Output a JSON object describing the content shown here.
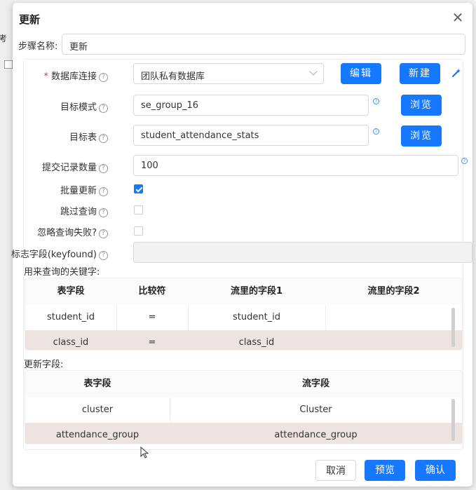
{
  "background": {
    "fragment_text": "考"
  },
  "dialog": {
    "title": "更新",
    "close_symbol": "✕",
    "step_name_label": "步骤名称:",
    "step_name_value": "更新"
  },
  "form": {
    "db_connection": {
      "label": "数据库连接",
      "required_mark": "*",
      "value": "团队私有数据库",
      "edit_label": "编辑",
      "new_label": "新建"
    },
    "target_schema": {
      "label": "目标模式",
      "value": "se_group_16",
      "browse_label": "浏览"
    },
    "target_table": {
      "label": "目标表",
      "value": "student_attendance_stats",
      "browse_label": "浏览"
    },
    "commit_size": {
      "label": "提交记录数量",
      "value": "100"
    },
    "batch_update": {
      "label": "批量更新",
      "checked": true
    },
    "skip_lookup": {
      "label": "跳过查询",
      "checked": false
    },
    "ignore_lookup_failure": {
      "label": "忽略查询失败?",
      "checked": false
    },
    "flag_field": {
      "label": "标志字段(keyfound)",
      "value": ""
    },
    "help_symbol": "?"
  },
  "key_table": {
    "section_label": "用来查询的关键字:",
    "headers": [
      "表字段",
      "比较符",
      "流里的字段1",
      "流里的字段2"
    ],
    "rows": [
      [
        "student_id",
        "=",
        "student_id",
        ""
      ],
      [
        "class_id",
        "=",
        "class_id",
        ""
      ]
    ]
  },
  "update_table": {
    "section_label": "更新字段:",
    "headers": [
      "表字段",
      "流字段"
    ],
    "rows": [
      [
        "cluster",
        "Cluster"
      ],
      [
        "attendance_group",
        "attendance_group"
      ]
    ]
  },
  "footer": {
    "cancel_label": "取消",
    "preview_label": "预览",
    "confirm_label": "确认"
  },
  "colors": {
    "primary": "#1677ff",
    "highlight_row": "#ede4e1",
    "required": "#e53935"
  }
}
